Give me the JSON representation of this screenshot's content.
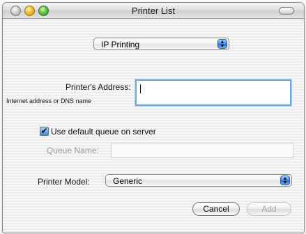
{
  "window": {
    "title": "Printer List"
  },
  "connection": {
    "selected": "IP Printing"
  },
  "address": {
    "label": "Printer's Address:",
    "sublabel": "Internet address or DNS name",
    "value": ""
  },
  "queue": {
    "checkbox_label": "Use default queue on server",
    "checked": "✔",
    "name_label": "Queue Name:",
    "name_value": ""
  },
  "model": {
    "label": "Printer Model:",
    "selected": "Generic"
  },
  "buttons": {
    "cancel": "Cancel",
    "add": "Add"
  },
  "icons": {
    "popup_arrows": "⬆⬇"
  }
}
